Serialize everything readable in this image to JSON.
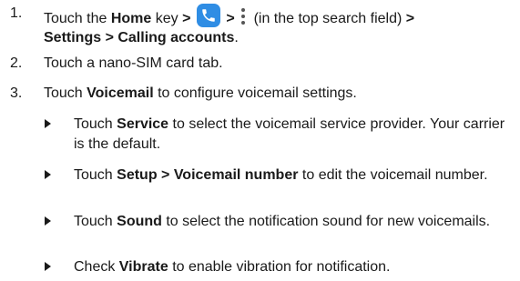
{
  "steps": [
    {
      "number": "1.",
      "segments": {
        "a": "Touch the ",
        "b": "Home",
        "c": " key ",
        "d": ">",
        "e": " ",
        "f": ">",
        "g": " (in the top search field) ",
        "h": ">",
        "i": "Settings > Calling accounts",
        "j": "."
      },
      "icons": [
        "phone-app-icon",
        "more-options-icon"
      ]
    },
    {
      "number": "2.",
      "text": "Touch a nano-SIM card tab."
    },
    {
      "number": "3.",
      "segments": {
        "a": "Touch ",
        "b": "Voicemail",
        "c": " to configure voicemail settings."
      }
    }
  ],
  "bullets": [
    {
      "pre": "Touch ",
      "bold": "Service",
      "post": " to select the voicemail service provider. Your carrier is the default."
    },
    {
      "pre": "Touch ",
      "bold": "Setup > Voicemail number",
      "post": " to edit the voicemail number."
    },
    {
      "pre": "Touch ",
      "bold": "Sound",
      "post": " to select the notification sound for new voicemails."
    },
    {
      "pre": "Check ",
      "bold": "Vibrate",
      "post": " to enable vibration for notification."
    }
  ],
  "colors": {
    "text": "#1a1a1a",
    "phone_icon_bg": "#2f8de4"
  }
}
